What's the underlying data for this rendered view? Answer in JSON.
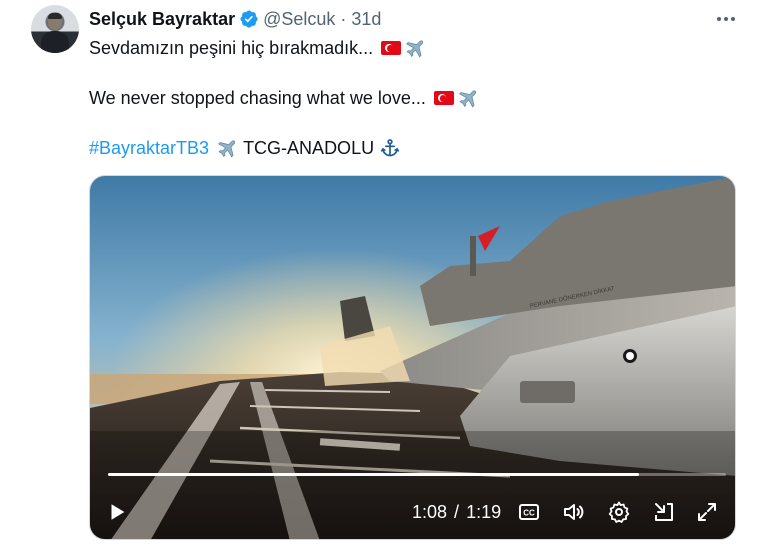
{
  "author": {
    "name": "Selçuk Bayraktar",
    "handle": "@Selcuk",
    "separator": "·",
    "time": "31d"
  },
  "icons": {
    "verified": "verified-badge-icon",
    "more": "more-options-icon",
    "flag": "turkish-flag-icon",
    "plane": "airplane-icon",
    "anchor": "anchor-icon"
  },
  "tweet": {
    "line1": "Sevdamızın peşini hiç bırakmadık...",
    "line2": "We never stopped chasing what we love...",
    "hashtag": "#BayraktarTB3",
    "line3_rest": "TCG-ANADOLU"
  },
  "video": {
    "current_time": "1:08",
    "time_separator": "/",
    "duration": "1:19",
    "progress": 0.86,
    "controls": [
      "play",
      "closed-captions",
      "volume",
      "settings",
      "minimize",
      "fullscreen"
    ],
    "hull_text": "PERVANE DÖNERKEN DİKKAT"
  },
  "colors": {
    "link": "#1d9bf0",
    "verified": "#1d9bf0",
    "secondary_text": "#536471",
    "flag_red": "#e30a17"
  }
}
